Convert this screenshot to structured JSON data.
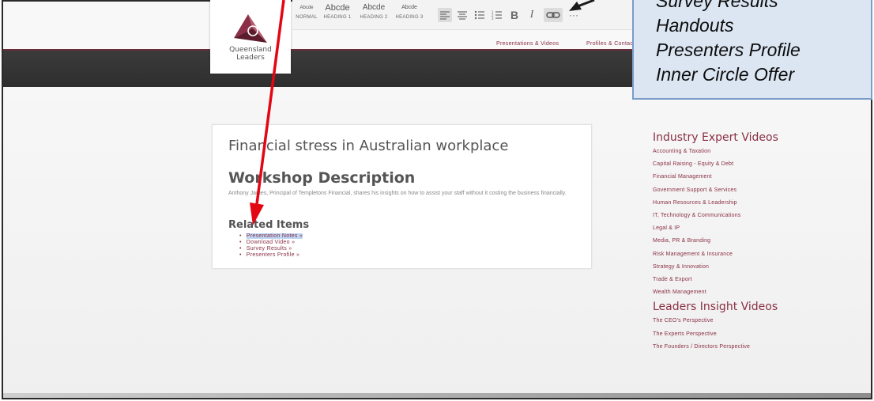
{
  "logo": {
    "line1": "Queensland",
    "line2": "Leaders"
  },
  "toolbar": {
    "styles": [
      {
        "preview": "Abcde",
        "caption": "NORMAL"
      },
      {
        "preview": "Abcde",
        "caption": "HEADING 1"
      },
      {
        "preview": "Abcde",
        "caption": "HEADING 2"
      },
      {
        "preview": "Abcde",
        "caption": "HEADING 3"
      }
    ],
    "bold": "B",
    "italic": "I",
    "link_glyph": "⧟",
    "more": "···"
  },
  "nav": {
    "videos": "Presentations & Videos",
    "profiles": "Profiles & Contacts"
  },
  "callout": {
    "lines": [
      "Survey Results",
      "Handouts",
      "Presenters Profile",
      "Inner Circle Offer"
    ]
  },
  "article": {
    "title": "Financial stress in Australian workplace",
    "workshop_heading": "Workshop Description",
    "description": "Anthony James, Principal of Templetons Financial, shares his insights on how to assist your staff without it costing the business financially.",
    "related_heading": "Related Items",
    "related_items": [
      "Presentation Notes »",
      "Download Video »",
      "Survey Results »",
      "Presenters Profile »"
    ]
  },
  "sidebar": {
    "industry_heading": "Industry Expert Videos",
    "industry_items": [
      "Accounting & Taxation",
      "Capital Raising - Equity & Debt",
      "Financial Management",
      "Government Support & Services",
      "Human Resources & Leadership",
      "IT, Technology & Communications",
      "Legal & IP",
      "Media, PR & Branding",
      "Risk Management & Insurance",
      "Strategy & Innovation",
      "Trade & Export",
      "Wealth Management"
    ],
    "leaders_heading": "Leaders Insight Videos",
    "leaders_items": [
      "The CEO's Perspective",
      "The Experts Perspective",
      "The Founders / Directors Perspective"
    ]
  },
  "colors": {
    "accent": "#8a2f45",
    "callout_bg": "#dce6f3",
    "callout_border": "#7a9cc8",
    "arrow": "#e30613"
  }
}
